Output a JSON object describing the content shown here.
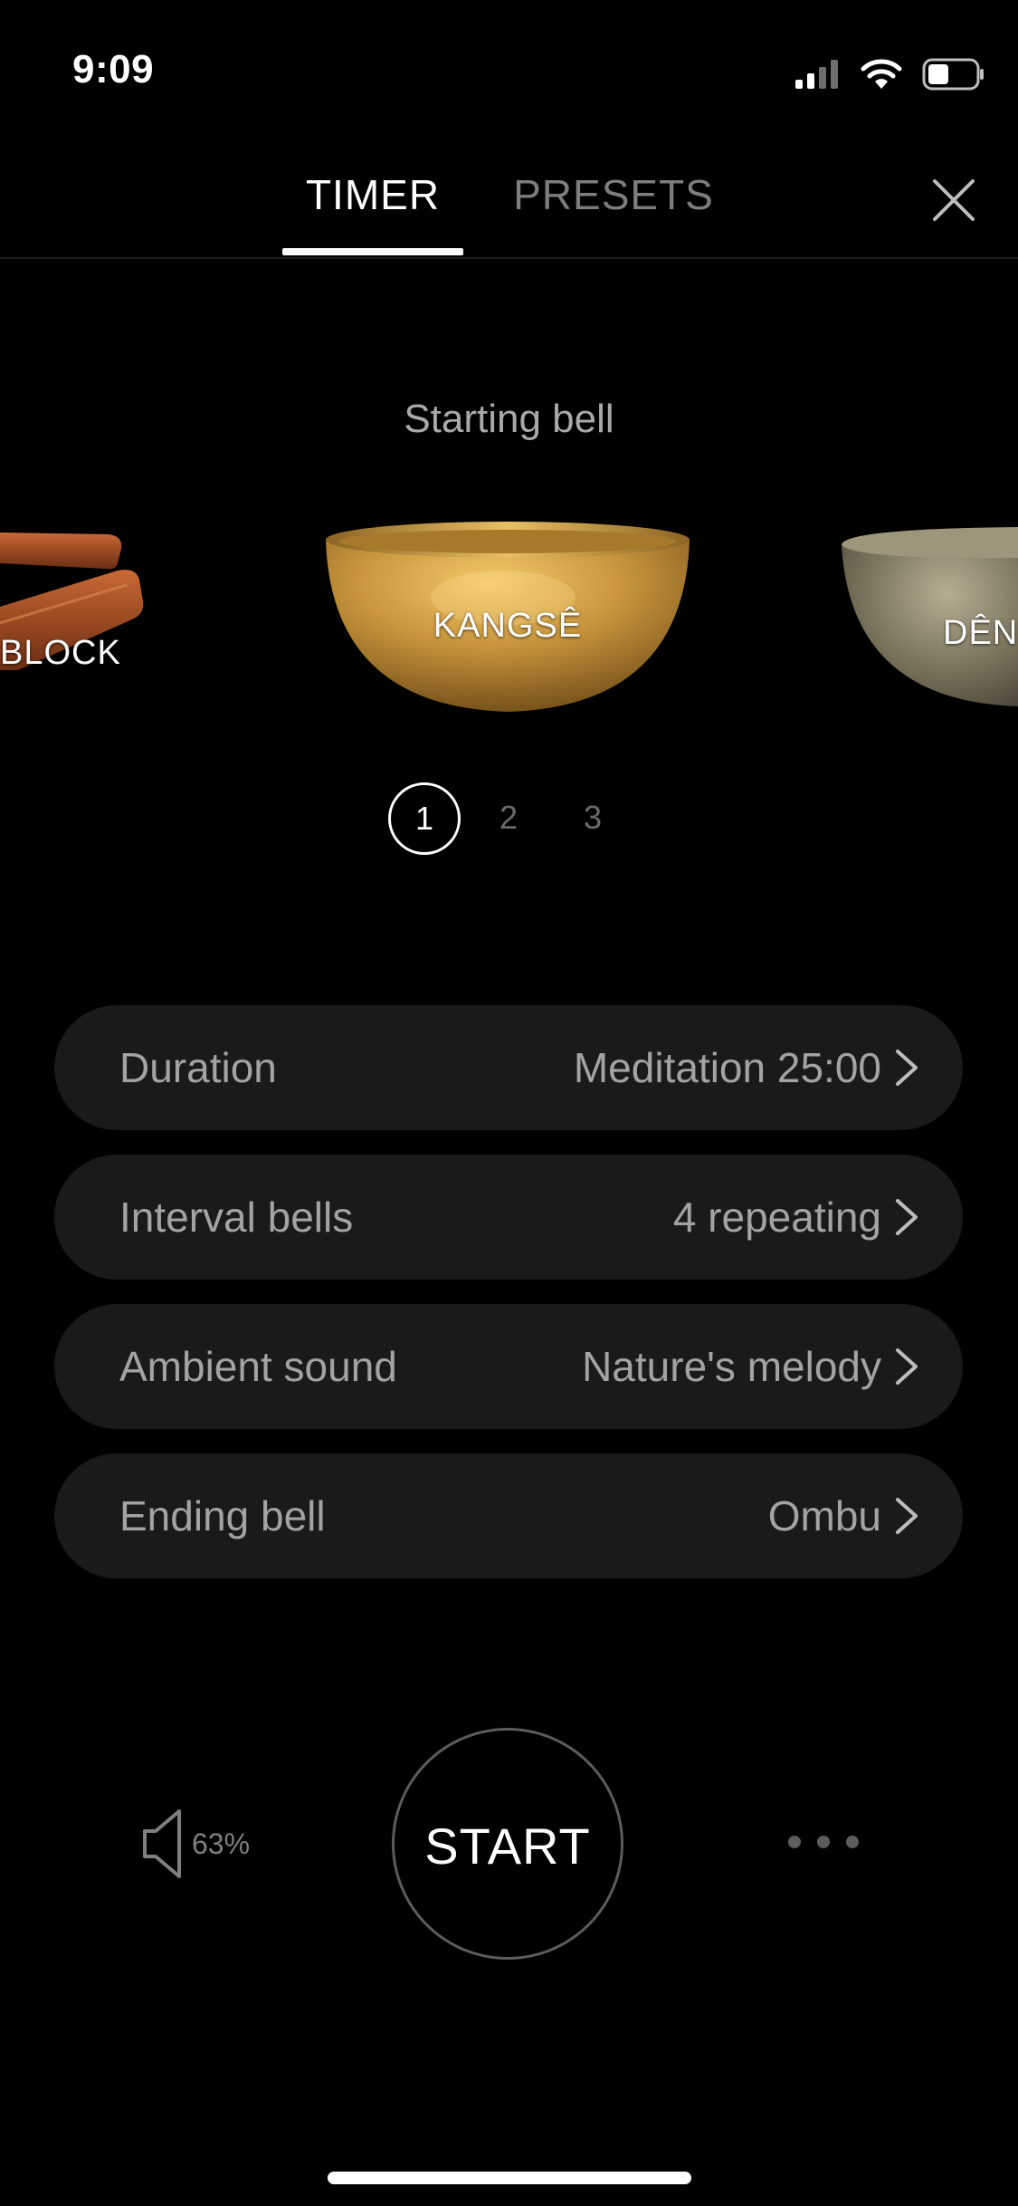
{
  "status_bar": {
    "time": "9:09",
    "icons": [
      "signal-icon",
      "wifi-icon",
      "battery-icon"
    ]
  },
  "tabs": [
    {
      "label": "TIMER",
      "active": true
    },
    {
      "label": "PRESETS",
      "active": false
    }
  ],
  "close_icon": "close-icon",
  "starting_bell": {
    "label": "Starting bell",
    "bells": [
      {
        "name": "BLOCK"
      },
      {
        "name": "KANGSÊ"
      },
      {
        "name": "DÊN"
      }
    ],
    "pages": [
      "1",
      "2",
      "3"
    ],
    "active_page": "1"
  },
  "settings": [
    {
      "label": "Duration",
      "value": "Meditation 25:00"
    },
    {
      "label": "Interval bells",
      "value": "4 repeating"
    },
    {
      "label": "Ambient sound",
      "value": "Nature's melody"
    },
    {
      "label": "Ending bell",
      "value": "Ombu"
    }
  ],
  "controls": {
    "volume": "63%",
    "start_label": "START",
    "more_icon": "more-icon"
  },
  "colors": {
    "background": "#000000",
    "row_background": "#1a1a1a",
    "muted_text": "#a3a3a3",
    "bowl_gold": "#c9963d"
  }
}
